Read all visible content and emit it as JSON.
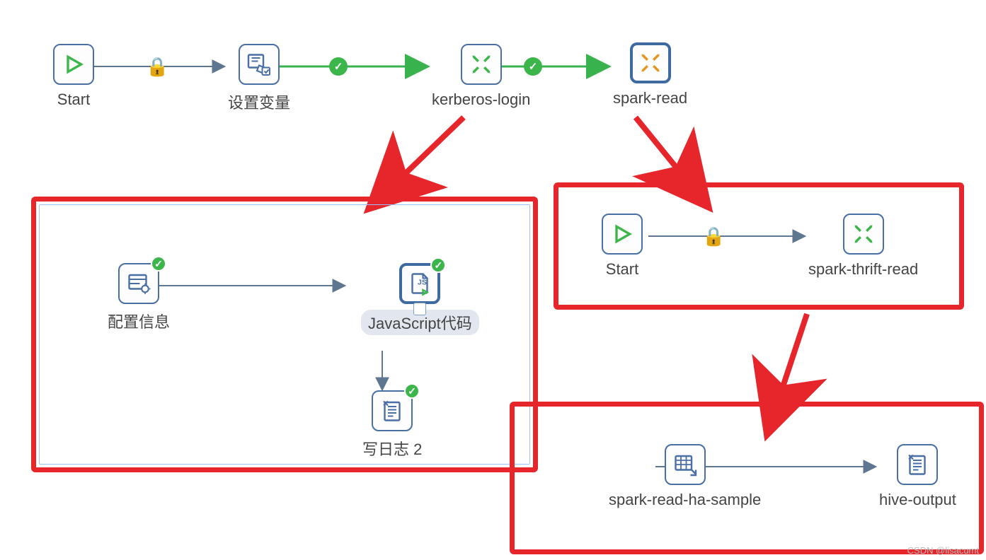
{
  "topRow": {
    "start": {
      "label": "Start"
    },
    "setVar": {
      "label": "设置变量"
    },
    "kerberos": {
      "label": "kerberos-login"
    },
    "sparkRead": {
      "label": "spark-read"
    }
  },
  "box1": {
    "config": {
      "label": "配置信息"
    },
    "js": {
      "label": "JavaScript代码"
    },
    "log": {
      "label": "写日志 2"
    }
  },
  "box2": {
    "start": {
      "label": "Start"
    },
    "thrift": {
      "label": "spark-thrift-read"
    }
  },
  "box3": {
    "sample": {
      "label": "spark-read-ha-sample"
    },
    "hive": {
      "label": "hive-output"
    }
  },
  "watermark": "CSDN @lisacumt"
}
